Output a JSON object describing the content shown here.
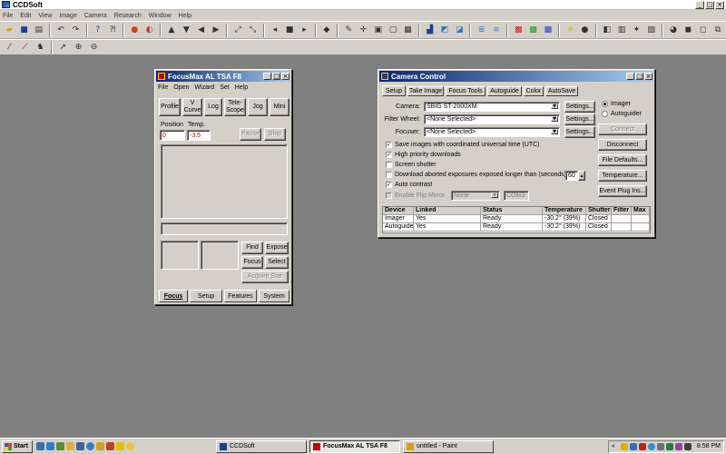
{
  "app": {
    "title": "CCDSoft"
  },
  "menubar": [
    "File",
    "Edit",
    "View",
    "Image",
    "Camera",
    "Research",
    "Window",
    "Help"
  ],
  "toolbar1_icons": [
    "open-icon",
    "save-icon",
    "print-icon",
    "undo-icon",
    "redo-icon",
    "help-icon",
    "whats-this-icon",
    "link-icon",
    "unlink-icon",
    "up-arrow-icon",
    "down-arrow-icon",
    "left-arrow-icon",
    "right-arrow-icon",
    "zoom-fit-icon",
    "zoom-full-icon",
    "prev-icon",
    "stop-icon",
    "next-icon",
    "filter-icon",
    "pen-icon",
    "crosshair-icon",
    "frame-icon",
    "frame2-icon",
    "box-icon",
    "histogram-icon",
    "image-icon",
    "image2-icon",
    "stack-icon",
    "stack2-icon",
    "color-icon",
    "color2-icon",
    "color3-icon",
    "sun-icon",
    "ball-icon",
    "invert-icon",
    "noise-icon",
    "star-field-icon",
    "mosaic-icon",
    "moon-icon",
    "dark-icon",
    "flat-icon",
    "window-icon"
  ],
  "toolbar2_icons": [
    "wand-icon",
    "telescope-icon",
    "cow-icon",
    "pointer-icon",
    "zoom-in-icon",
    "zoom-out-icon"
  ],
  "focusmax": {
    "title": "FocusMax   AL TSA F8",
    "menu": [
      "File",
      "Open",
      "Wizard",
      "Set",
      "Help"
    ],
    "buttons": {
      "profile": "Profile",
      "vcurve": "V Curve",
      "log": "Log",
      "telescope": "Tele-Scope",
      "jog": "Jog",
      "mini": "Mini",
      "pause": "Pause",
      "stop": "Stop",
      "find": "Find",
      "expose": "Expose",
      "focus": "Focus",
      "select": "Select",
      "acquire": "Acquire Star"
    },
    "position_label": "Position",
    "temp_label": "Temp.",
    "position_value": "0",
    "temp_value": "-3.5",
    "tabs": [
      "Focus",
      "Setup",
      "Features",
      "System"
    ]
  },
  "camera": {
    "title": "Camera Control",
    "tabs": [
      "Setup",
      "Take Image",
      "Focus Tools",
      "Autoguide",
      "Color",
      "AutoSave"
    ],
    "camera_label": "Camera:",
    "camera_value": "SBIG ST-2000XM",
    "filter_label": "Filter Wheel:",
    "filter_value": "<None Selected>",
    "focuser_label": "Focuser:",
    "focuser_value": "<None Selected>",
    "settings_label": "Settings...",
    "radio_imager": "Imager",
    "radio_autoguider": "Autoguider",
    "checks": [
      {
        "label": "Save images with coordinated universal time (UTC)",
        "checked": true
      },
      {
        "label": "High priority downloads",
        "checked": true
      },
      {
        "label": "Screen shutter",
        "checked": false
      },
      {
        "label": "Download aborted exposures exposed longer than (seconds):",
        "checked": false
      },
      {
        "label": "Auto contrast",
        "checked": true
      },
      {
        "label": "Enable Flip Mirror",
        "checked": false
      }
    ],
    "download_seconds": "60",
    "flip_combo": "None",
    "com_port": "COM3",
    "buttons": {
      "connect": "Connect",
      "disconnect": "Disconnect",
      "file_defaults": "File Defaults...",
      "temperature": "Temperature...",
      "event_plugins": "Event Plug Ins..."
    },
    "table": {
      "columns": [
        "Device",
        "Linked",
        "Status",
        "Temperature",
        "Shutter",
        "Filter",
        "Max"
      ],
      "rows": [
        [
          "Imager",
          "Yes",
          "Ready",
          "-30.2° (39%)",
          "Closed",
          "",
          ""
        ],
        [
          "Autoguider",
          "Yes",
          "Ready",
          "-30.2° (39%)",
          "Closed",
          "",
          ""
        ]
      ]
    }
  },
  "taskbar": {
    "start": "Start",
    "tasks": [
      "CCDSoft",
      "FocusMax   AL TSA F8",
      "untitled - Paint"
    ],
    "clock": "8:58 PM"
  }
}
